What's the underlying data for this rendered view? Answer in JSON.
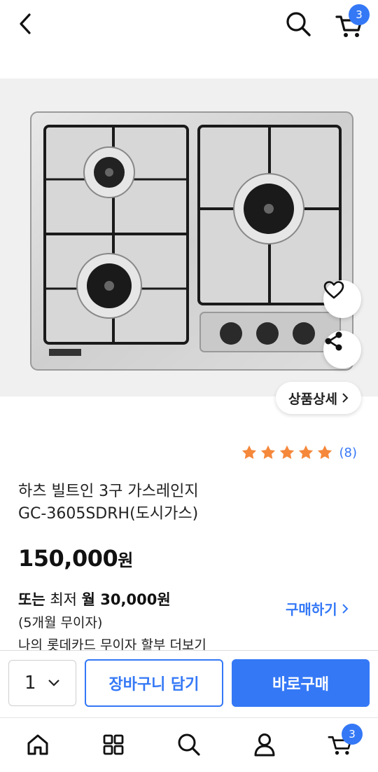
{
  "header": {
    "cart_count": "3"
  },
  "gallery": {
    "detail_label": "상품상세"
  },
  "product": {
    "rating_stars": 5,
    "review_count": "(8)",
    "title_line1": "하츠 빌트인 3구 가스레인지",
    "title_line2": "GC-3605SDRH(도시가스)",
    "price_number": "150,000",
    "price_unit": "원"
  },
  "installment": {
    "prefix": "또는",
    "min_label": "최저",
    "monthly_label": "월 30,000원",
    "months": "(5개월 무이자)",
    "card_more": "나의 롯데카드 무이자 할부 더보기",
    "buy_link": "구매하기"
  },
  "purchase": {
    "quantity": "1",
    "add_to_cart": "장바구니 담기",
    "buy_now": "바로구매"
  },
  "bottom_nav": {
    "cart_count": "3"
  },
  "colors": {
    "accent": "#3478f6",
    "star": "#f5883b"
  }
}
